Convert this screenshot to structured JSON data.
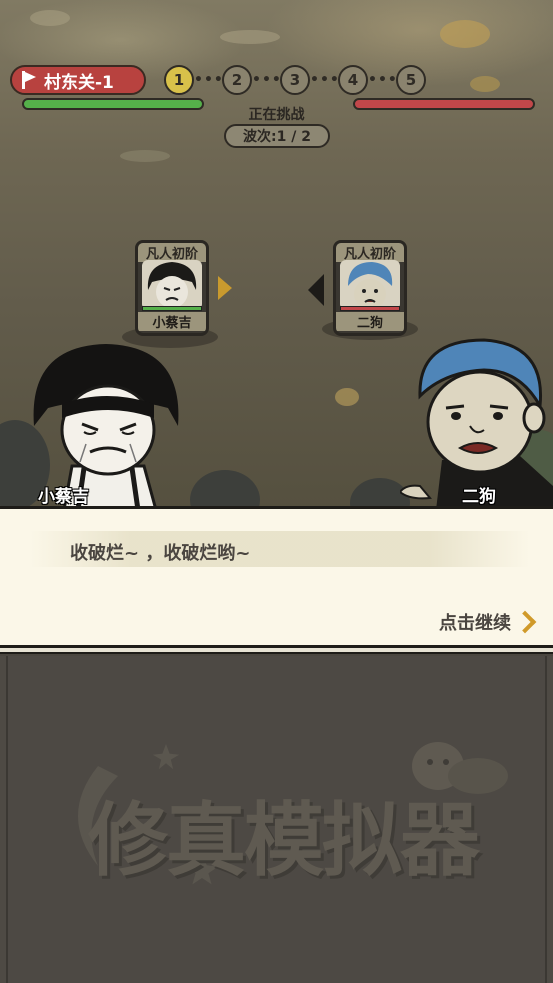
{
  "hud": {
    "stage_label": "村东关-1",
    "challenge_status": "正在挑战",
    "wave_label": "波次:1 / 2",
    "wave_nodes": [
      "1",
      "2",
      "3",
      "4",
      "5"
    ],
    "wave_connector": "•••"
  },
  "cards": {
    "left": {
      "rank": "凡人初阶",
      "name": "小蔡吉"
    },
    "right": {
      "rank": "凡人初阶",
      "name": "二狗"
    }
  },
  "speakers": {
    "left_name": "小蔡吉",
    "right_name": "二狗"
  },
  "dialog": {
    "text": "收破烂~ ，收破烂哟~",
    "continue_label": "点击继续"
  },
  "logo": {
    "title": "修真模拟器"
  },
  "colors": {
    "player_hp": "#55b04a",
    "enemy_hp": "#c2474a",
    "stage_badge": "#b8423f",
    "active_wave": "#d8c14a",
    "continue_arrow": "#d09a2a"
  }
}
